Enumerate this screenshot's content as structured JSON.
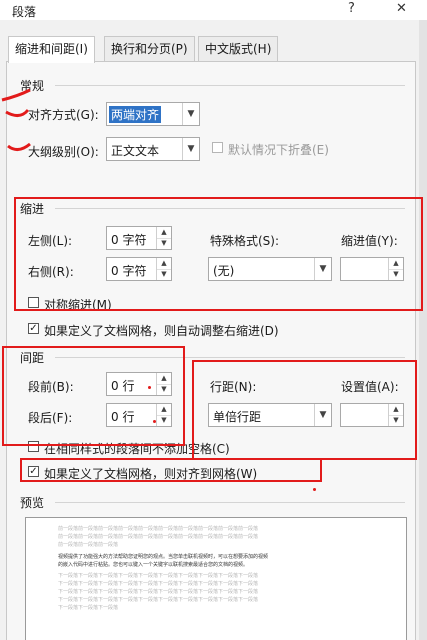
{
  "window": {
    "title": "段落",
    "help": "?",
    "close": "✕"
  },
  "tabs": [
    {
      "label": "缩进和间距(I)",
      "active": true
    },
    {
      "label": "换行和分页(P)",
      "active": false
    },
    {
      "label": "中文版式(H)",
      "active": false
    }
  ],
  "general": {
    "title": "常规",
    "alignment_label": "对齐方式(G):",
    "alignment_value": "两端对齐",
    "outline_label": "大纲级别(O):",
    "outline_value": "正文文本",
    "collapse_label": "默认情况下折叠(E)"
  },
  "indent": {
    "title": "缩进",
    "left_label": "左侧(L):",
    "left_value": "0 字符",
    "right_label": "右侧(R):",
    "right_value": "0 字符",
    "special_label": "特殊格式(S):",
    "special_value": "(无)",
    "indent_value_label": "缩进值(Y):",
    "indent_value": "",
    "mirror_label": "对称缩进(M)",
    "auto_adjust_label": "如果定义了文档网格，则自动调整右缩进(D)"
  },
  "spacing": {
    "title": "间距",
    "before_label": "段前(B):",
    "before_value": "0 行",
    "after_label": "段后(F):",
    "after_value": "0 行",
    "line_spacing_label": "行距(N):",
    "line_spacing_value": "单倍行距",
    "set_value_label": "设置值(A):",
    "set_value": "",
    "no_space_label": "在相同样式的段落间不添加空格(C)",
    "snap_grid_label": "如果定义了文档网格，则对齐到网格(W)"
  },
  "preview": {
    "title": "预览",
    "lines_prev": [
      "前一段落前一段落前一段落前一段落前一段落前一段落前一段落前一段落前一段落前一段落",
      "前一段落前一段落前一段落前一段落前一段落前一段落前一段落前一段落前一段落前一段落",
      "前一段落前一段落前一段落"
    ],
    "lines_sample": [
      "视频提供了功能强大的方法帮助您证明您的观点。当您单击联机视频时，可以在想要添加的视频",
      "的嵌入代码中进行粘贴。您也可以键入一个关键字以联机搜索最适合您的文档的视频。"
    ],
    "lines_next": [
      "下一段落下一段落下一段落下一段落下一段落下一段落下一段落下一段落下一段落下一段落",
      "下一段落下一段落下一段落下一段落下一段落下一段落下一段落下一段落下一段落下一段落",
      "下一段落下一段落下一段落下一段落下一段落下一段落下一段落下一段落下一段落下一段落",
      "下一段落下一段落下一段落下一段落下一段落下一段落下一段落下一段落下一段落下一段落",
      "下一段落下一段落下一段落"
    ]
  },
  "colors": {
    "annotation_red": "#e21b1b",
    "selection_blue": "#2f73c6",
    "background_green": "#1f8a47"
  }
}
